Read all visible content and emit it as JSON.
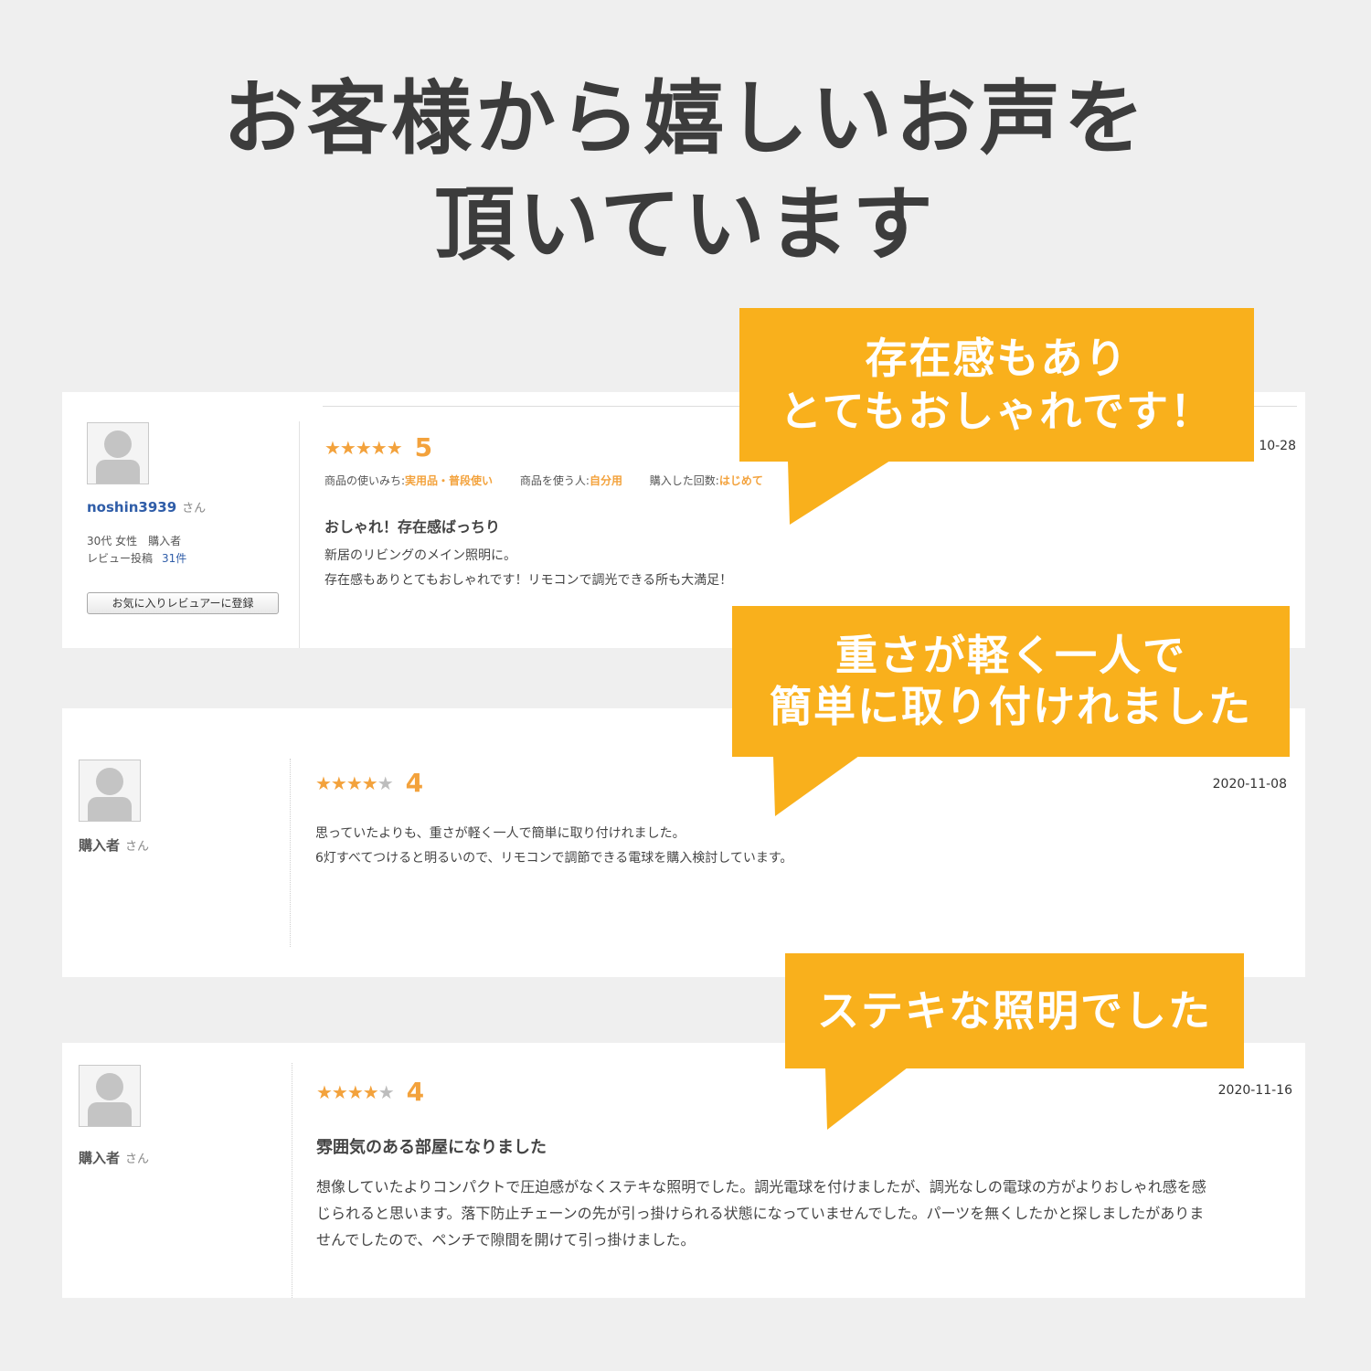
{
  "headline": {
    "line1": "お客様から嬉しいお声を",
    "line2": "頂いています"
  },
  "colors": {
    "bubble": "#f9b01c",
    "star": "#f3a23c",
    "star_off": "#bdbdbd",
    "link": "#2f5da8"
  },
  "reviews": [
    {
      "user": "noshin3939",
      "honorific": "さん",
      "demographics": "30代 女性　購入者",
      "review_count_label": "レビュー投稿",
      "review_count": "31件",
      "favorite_button": "お気に入りレビュアーに登録",
      "rating": 5,
      "stars": "★★★★★",
      "date": "10-28",
      "attrs": [
        {
          "label": "商品の使いみち:",
          "value": "実用品・普段使い"
        },
        {
          "label": "商品を使う人:",
          "value": "自分用"
        },
        {
          "label": "購入した回数:",
          "value": "はじめて"
        }
      ],
      "title": "おしゃれ！存在感ばっちり",
      "body": [
        "新居のリビングのメイン照明に。",
        "存在感もありとてもおしゃれです！リモコンで調光できる所も大満足！"
      ],
      "callout": [
        "存在感もあり",
        "とてもおしゃれです！"
      ]
    },
    {
      "user": "購入者",
      "honorific": "さん",
      "rating": 4,
      "stars_on": "★★★★",
      "stars_off": "★",
      "date": "2020-11-08",
      "body": [
        "思っていたよりも、重さが軽く一人で簡単に取り付けれました。",
        "6灯すべてつけると明るいので、リモコンで調節できる電球を購入検討しています。"
      ],
      "callout": [
        "重さが軽く一人で",
        "簡単に取り付けれました"
      ]
    },
    {
      "user": "購入者",
      "honorific": "さん",
      "rating": 4,
      "stars_on": "★★★★",
      "stars_off": "★",
      "date": "2020-11-16",
      "title": "雰囲気のある部屋になりました",
      "body": [
        "想像していたよりコンパクトで圧迫感がなくステキな照明でした。調光電球を付けましたが、調光なしの電球の方がよりおしゃれ感を感",
        "じられると思います。落下防止チェーンの先が引っ掛けられる状態になっていませんでした。パーツを無くしたかと探しましたがありま",
        "せんでしたので、ペンチで隙間を開けて引っ掛けました。"
      ],
      "callout": [
        "ステキな照明でした"
      ]
    }
  ]
}
